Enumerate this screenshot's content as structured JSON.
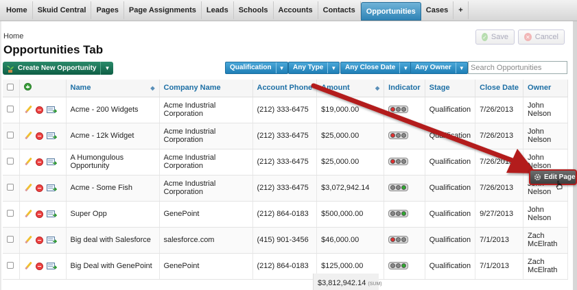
{
  "tabs": [
    {
      "label": "Home",
      "active": false
    },
    {
      "label": "Skuid Central",
      "active": false
    },
    {
      "label": "Pages",
      "active": false
    },
    {
      "label": "Page Assignments",
      "active": false
    },
    {
      "label": "Leads",
      "active": false
    },
    {
      "label": "Schools",
      "active": false
    },
    {
      "label": "Accounts",
      "active": false
    },
    {
      "label": "Contacts",
      "active": false
    },
    {
      "label": "Opportunities",
      "active": true
    },
    {
      "label": "Cases",
      "active": false
    },
    {
      "label": "+",
      "active": false
    }
  ],
  "header": {
    "breadcrumb": "Home",
    "title": "Opportunities Tab",
    "save_label": "Save",
    "cancel_label": "Cancel"
  },
  "toolbar": {
    "create_label": "Create New Opportunity",
    "filters": [
      "Qualification",
      "Any Type",
      "Any Close Date",
      "Any Owner"
    ],
    "search_placeholder": "Search Opportunities"
  },
  "table": {
    "columns": [
      "Name",
      "Company Name",
      "Account Phone",
      "Amount",
      "Indicator",
      "Stage",
      "Close Date",
      "Owner"
    ],
    "rows": [
      {
        "name": "Acme - 200 Widgets",
        "company": "Acme Industrial Corporation",
        "phone": "(212) 333-6475",
        "amount": "$19,000.00",
        "indicator": "red",
        "stage": "Qualification",
        "close": "7/26/2013",
        "owner": "John Nelson"
      },
      {
        "name": "Acme - 12k Widget",
        "company": "Acme Industrial Corporation",
        "phone": "(212) 333-6475",
        "amount": "$25,000.00",
        "indicator": "red",
        "stage": "Qualification",
        "close": "7/26/2013",
        "owner": "John Nelson"
      },
      {
        "name": "A Humongulous Opportunity",
        "company": "Acme Industrial Corporation",
        "phone": "(212) 333-6475",
        "amount": "$25,000.00",
        "indicator": "red",
        "stage": "Qualification",
        "close": "7/26/2013",
        "owner": "John Nelson"
      },
      {
        "name": "Acme - Some Fish",
        "company": "Acme Industrial Corporation",
        "phone": "(212) 333-6475",
        "amount": "$3,072,942.14",
        "indicator": "green",
        "stage": "Qualification",
        "close": "7/26/2013",
        "owner": "John Nelson"
      },
      {
        "name": "Super Opp",
        "company": "GenePoint",
        "phone": "(212) 864-0183",
        "amount": "$500,000.00",
        "indicator": "green",
        "stage": "Qualification",
        "close": "9/27/2013",
        "owner": "John Nelson"
      },
      {
        "name": "Big deal with Salesforce",
        "company": "salesforce.com",
        "phone": "(415) 901-3456",
        "amount": "$46,000.00",
        "indicator": "red",
        "stage": "Qualification",
        "close": "7/1/2013",
        "owner": "Zach McElrath"
      },
      {
        "name": "Big Deal with GenePoint",
        "company": "GenePoint",
        "phone": "(212) 864-0183",
        "amount": "$125,000.00",
        "indicator": "green",
        "stage": "Qualification",
        "close": "7/1/2013",
        "owner": "Zach McElrath"
      }
    ],
    "sum_value": "$3,812,942.14",
    "sum_label": "(SUM)"
  },
  "overlay": {
    "edit_page_label": "Edit Page"
  },
  "colors": {
    "active_tab": "#2f84b6",
    "create_button": "#1b7356",
    "filter_button": "#2e8fc7",
    "arrow": "#b31d1d",
    "indicator_red": "#e03030",
    "indicator_green": "#2ea82e",
    "indicator_off": "#8a8a8a"
  }
}
